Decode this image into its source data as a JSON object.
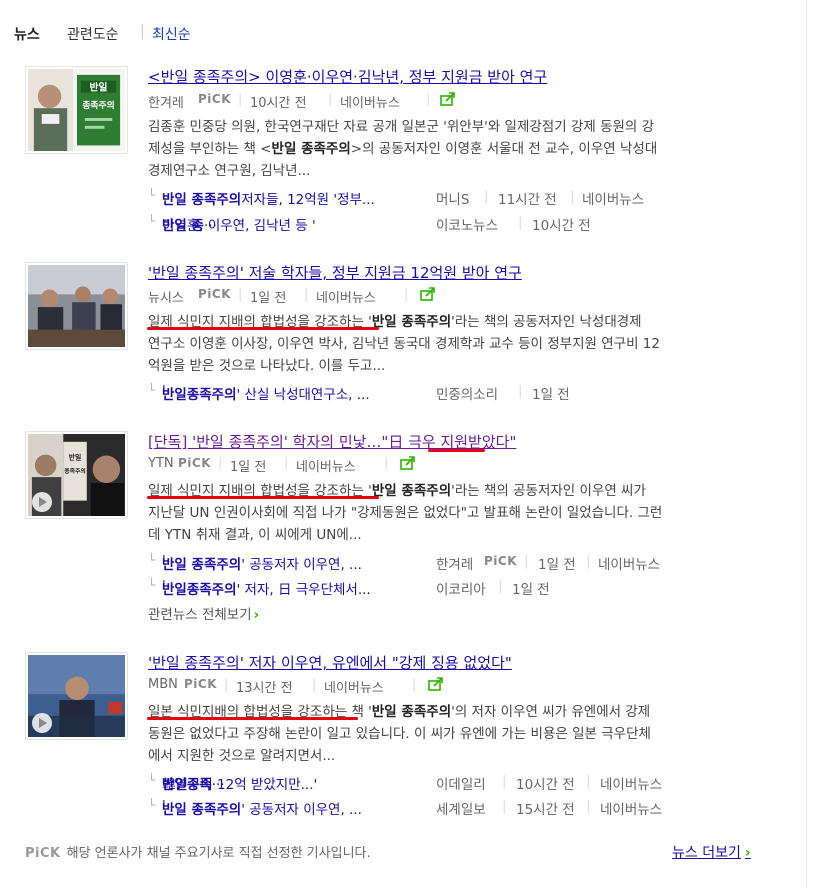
{
  "sort": {
    "news": "뉴스",
    "related_books": "관련도순",
    "latest": "최신순"
  },
  "colors": {
    "link": "#1a0dab",
    "visited": "#6a1b9a",
    "pick_green": "#2db400",
    "underline_red": "#e60012"
  },
  "articles": [
    {
      "title": "<반일 종족주의> 이영훈·이우연·김낙년, 정부 지원금 받아 연구",
      "source": "한겨레",
      "pick": "PiCK",
      "time": "10시간 전",
      "portal": "네이버뉴스",
      "desc_l1_a": "김종훈 민중당 의원, 한국연구재단 자료 공개 일본군 '위안부'와 일제강점기 강제 동원의 강",
      "desc_l2_a": "제성을 부인하는 책 <",
      "desc_l2_b": "반일 종족주의",
      "desc_l2_c": ">의 공동저자인 이영훈 서울대 전 교수, 이우연 낙성대",
      "desc_l3": "경제연구소 연구원, 김낙년...",
      "related": [
        {
          "pre": "",
          "bold": "반일 종족주의",
          "post": " 저자들, 12억원 '정부...",
          "source": "머니S",
          "time": "11시간 전",
          "portal": "네이버뉴스"
        },
        {
          "pre": "이영훈, 이우연, 김낙년 등 '",
          "bold": "반일 종",
          "post": "...",
          "source": "이코노뉴스",
          "time": "10시간 전",
          "portal": ""
        }
      ]
    },
    {
      "title": "'반일 종족주의' 저술 학자들, 정부 지원금 12억원 받아 연구",
      "source": "뉴시스",
      "pick": "PiCK",
      "time": "1일 전",
      "portal": "네이버뉴스",
      "desc_l1_a": "일제 식민지 지배의 합법성을 강조하는 '",
      "desc_l1_b": "반일 종족주의",
      "desc_l1_c": "'라는 책의 공동저자인 낙성대경제",
      "desc_l2": "연구소 이영훈 이사장, 이우연 박사, 김낙년 동국대 경제학과 교수 등이 정부지원 연구비 12",
      "desc_l3": "억원을 받은 것으로 나타났다. 이를 두고...",
      "related": [
        {
          "pre": "'",
          "bold": "반일종족주의",
          "post": "' 산실 낙성대연구소, ...",
          "source": "민중의소리",
          "time": "1일 전",
          "portal": ""
        }
      ]
    },
    {
      "title": "[단독] '반일 종족주의' 학자의 민낯…\"日 극우 지원받았다\"",
      "source": "YTN",
      "pick": "PiCK",
      "time": "1일 전",
      "portal": "네이버뉴스",
      "desc_l1_a": "일제 식민지 지배의 합법성을 강조하는 '",
      "desc_l1_b": "반일 종족주의",
      "desc_l1_c": "'라는 책의 공동저자인 이우연 씨가",
      "desc_l2": "지난달 UN 인권이사회에 직접 나가 \"강제동원은 없었다\"고 발표해 논란이 일었습니다. 그런",
      "desc_l3": "데 YTN 취재 결과, 이 씨에게 UN에...",
      "related": [
        {
          "pre": "'",
          "bold": "반일 종족주의",
          "post": "' 공동저자 이우연, ...",
          "source": "한겨레",
          "source_pick": "PiCK",
          "time": "1일 전",
          "portal": "네이버뉴스"
        },
        {
          "pre": "'",
          "bold": "반일종족주의",
          "post": "' 저자, 日 극우단체서...",
          "source": "이코리아",
          "time": "1일 전",
          "portal": ""
        }
      ],
      "more_related": "관련뉴스 전체보기"
    },
    {
      "title": "'반일 종족주의' 저자 이우연, 유엔에서 \"강제 징용 없었다\"",
      "source": "MBN",
      "pick": "PiCK",
      "time": "13시간 전",
      "portal": "네이버뉴스",
      "desc_l1_a": "일본 식민지배의 합법성을 강조하는 책 '",
      "desc_l1_b": "반일 종족주의",
      "desc_l1_c": "'의 저자 이우연 씨가 유엔에서 강제",
      "desc_l2": "동원은 없었다고 주장해 논란이 일고 있습니다. 이 씨가 유엔에 가는 비용은 일본 극우단체",
      "desc_l3": "에서 지원한 것으로 알려지면서...",
      "related": [
        {
          "pre": "韓연구비 12억 받았지만...'",
          "bold": "반일종족",
          "post": "...",
          "source": "이데일리",
          "time": "10시간 전",
          "portal": "네이버뉴스"
        },
        {
          "pre": "'",
          "bold": "반일 종족주의",
          "post": "' 공동저자 이우연, ...",
          "source": "세계일보",
          "time": "15시간 전",
          "portal": "네이버뉴스"
        }
      ]
    }
  ],
  "footer": {
    "pick": "PiCK",
    "text": "해당 언론사가 채널 주요기사로 직접 선정한 기사입니다.",
    "more_news": "뉴스 더보기"
  }
}
